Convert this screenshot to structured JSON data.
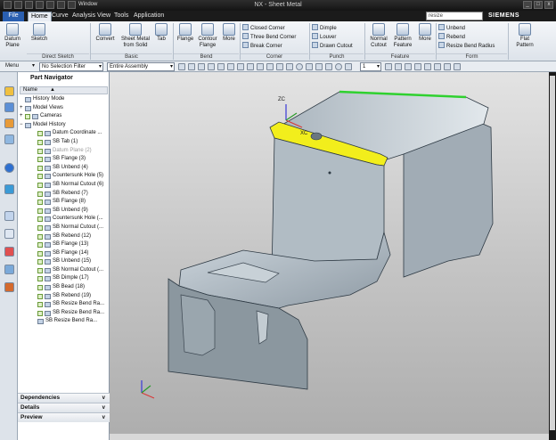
{
  "window": {
    "title": "NX - Sheet Metal",
    "brand": "SIEMENS",
    "quick_access": "Window"
  },
  "tabs": [
    "File",
    "Home",
    "Curve",
    "Analysis",
    "View",
    "Tools",
    "Application"
  ],
  "search": {
    "value": "resize"
  },
  "ribbon": {
    "big_buttons": [
      "Datum Plane",
      "Sketch",
      "Convert",
      "Sheet Metal from Solid",
      "Tab",
      "Flange",
      "Contour Flange",
      "More",
      "Normal Cutout",
      "Pattern Feature",
      "More",
      "Flat Pattern"
    ],
    "corner": [
      "Closed Corner",
      "Three Bend Corner",
      "Break Corner"
    ],
    "punch": [
      "Dimple",
      "Louver",
      "Drawn Cutout"
    ],
    "form": [
      "Unbend",
      "Rebend",
      "Resize Bend Radius"
    ],
    "groups": [
      "Direct Sketch",
      "Basic",
      "Bend",
      "Corner",
      "Punch",
      "Feature",
      "Form"
    ]
  },
  "selection_bar": {
    "menu": "Menu",
    "filter": "No Selection Filter",
    "scope": "Entire Assembly",
    "layer": "1"
  },
  "navigator": {
    "title": "Part Navigator",
    "column": "Name",
    "items": [
      {
        "label": "History Mode",
        "level": 0,
        "dim": false,
        "check": false
      },
      {
        "label": "Model Views",
        "level": 0,
        "dim": false,
        "check": false
      },
      {
        "label": "Cameras",
        "level": 0,
        "dim": false,
        "check": true
      },
      {
        "label": "Model History",
        "level": 0,
        "dim": false,
        "check": false
      },
      {
        "label": "Datum Coordinate ...",
        "level": 1,
        "dim": false,
        "check": true
      },
      {
        "label": "SB Tab (1)",
        "level": 1,
        "dim": false,
        "check": true
      },
      {
        "label": "Datum Plane (2)",
        "level": 1,
        "dim": true,
        "check": true
      },
      {
        "label": "SB Flange (3)",
        "level": 1,
        "dim": false,
        "check": true
      },
      {
        "label": "SB Unbend (4)",
        "level": 1,
        "dim": false,
        "check": true
      },
      {
        "label": "Countersunk Hole (5)",
        "level": 1,
        "dim": false,
        "check": true
      },
      {
        "label": "SB Normal Cutout (6)",
        "level": 1,
        "dim": false,
        "check": true
      },
      {
        "label": "SB Rebend (7)",
        "level": 1,
        "dim": false,
        "check": true
      },
      {
        "label": "SB Flange (8)",
        "level": 1,
        "dim": false,
        "check": true
      },
      {
        "label": "SB Unbend (9)",
        "level": 1,
        "dim": false,
        "check": true
      },
      {
        "label": "Countersunk Hole (...",
        "level": 1,
        "dim": false,
        "check": true
      },
      {
        "label": "SB Normal Cutout (...",
        "level": 1,
        "dim": false,
        "check": true
      },
      {
        "label": "SB Rebend (12)",
        "level": 1,
        "dim": false,
        "check": true
      },
      {
        "label": "SB Flange (13)",
        "level": 1,
        "dim": false,
        "check": true
      },
      {
        "label": "SB Flange (14)",
        "level": 1,
        "dim": false,
        "check": true
      },
      {
        "label": "SB Unbend (15)",
        "level": 1,
        "dim": false,
        "check": true
      },
      {
        "label": "SB Normal Cutout (...",
        "level": 1,
        "dim": false,
        "check": true
      },
      {
        "label": "SB Dimple (17)",
        "level": 1,
        "dim": false,
        "check": true
      },
      {
        "label": "SB Bead (18)",
        "level": 1,
        "dim": false,
        "check": true
      },
      {
        "label": "SB Rebend (19)",
        "level": 1,
        "dim": false,
        "check": true
      },
      {
        "label": "SB Resize Bend Ra...",
        "level": 1,
        "dim": false,
        "check": true
      },
      {
        "label": "SB Resize Bend Ra...",
        "level": 1,
        "dim": false,
        "check": true
      },
      {
        "label": "SB Resize Bend Ra...",
        "level": 1,
        "dim": false,
        "check": false
      }
    ],
    "footer": [
      "Dependencies",
      "Details",
      "Preview"
    ]
  },
  "viewport": {
    "triad_labels": [
      "ZC",
      "XC"
    ],
    "highlight_color": "#f2ee1c",
    "edge_color": "#2fd12f",
    "part_color": "#b7c3cc"
  }
}
